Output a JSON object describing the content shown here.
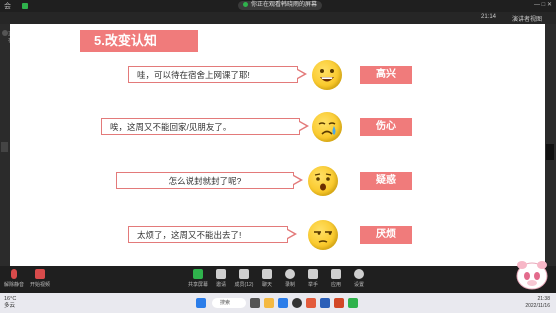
{
  "window": {
    "left_label": "会",
    "share_status": "你正在观看韩晓雨的屏幕",
    "right_controls": "— □ ✕",
    "time": "21:14",
    "speaker_view": "演讲者视图"
  },
  "left_rail": {
    "label": "正在"
  },
  "slide": {
    "title": "5.改变认知",
    "rows": [
      {
        "text": "哇，可以待在宿舍上网课了耶!",
        "emotion": "高兴",
        "emoji": "grinning-face"
      },
      {
        "text": "唉，这周又不能回家/见朋友了。",
        "emotion": "伤心",
        "emoji": "crying-face"
      },
      {
        "text": "怎么说封就封了呢?",
        "emotion": "疑惑",
        "emoji": "surprised-face"
      },
      {
        "text": "太烦了，这周又不能出去了!",
        "emotion": "厌烦",
        "emoji": "annoyed-face"
      }
    ]
  },
  "meeting_bar": {
    "left": [
      {
        "label": "解除静音",
        "icon": "microphone-icon"
      },
      {
        "label": "开始视频",
        "icon": "camera-icon"
      }
    ],
    "center": [
      {
        "label": "共享屏幕",
        "icon": "share-screen-icon"
      },
      {
        "label": "邀请",
        "icon": "invite-icon"
      },
      {
        "label": "成员(12)",
        "icon": "participants-icon"
      },
      {
        "label": "聊天",
        "icon": "chat-icon"
      },
      {
        "label": "录制",
        "icon": "record-icon"
      },
      {
        "label": "举手",
        "icon": "hand-icon"
      },
      {
        "label": "应用",
        "icon": "apps-icon"
      },
      {
        "label": "设置",
        "icon": "settings-icon"
      }
    ]
  },
  "taskbar": {
    "weather_line1": "16°C",
    "weather_line2": "多云",
    "search": "搜索",
    "clock_time": "21:38",
    "clock_date": "2022/11/16"
  },
  "colors": {
    "accent": "#f07b7b",
    "border": "#e37a7a",
    "emoji": "#f6b800"
  }
}
